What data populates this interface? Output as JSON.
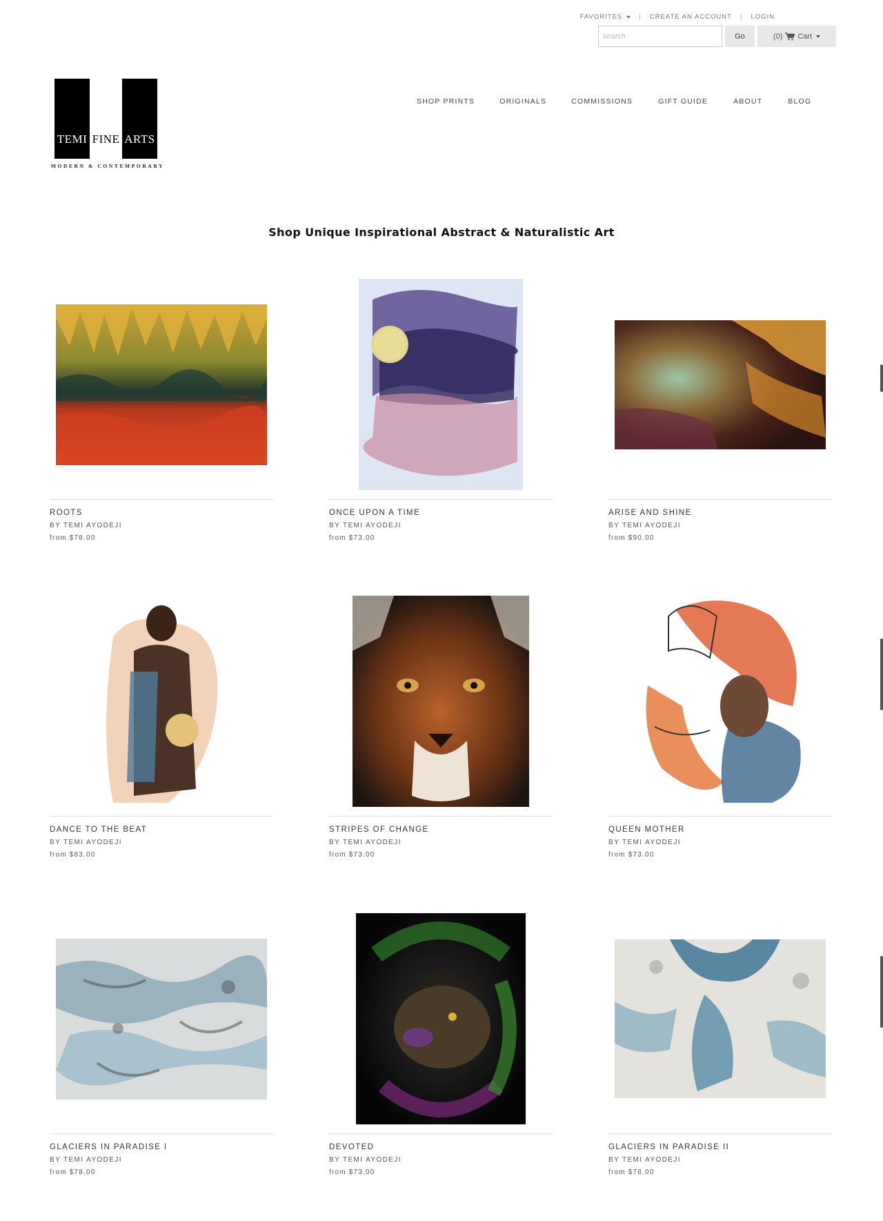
{
  "utility_nav": {
    "favorites": "FAVORITES",
    "create_account": "CREATE AN ACCOUNT",
    "login": "LOGIN",
    "separator": "|"
  },
  "search": {
    "placeholder": "search",
    "go_label": "Go",
    "cart_count": "(0)",
    "cart_label": "Cart"
  },
  "logo": {
    "word1": "TEMI",
    "word2": "FINE",
    "word3": "ARTS",
    "tagline": "MODERN & CONTEMPORARY"
  },
  "nav": {
    "items": [
      "SHOP PRINTS",
      "ORIGINALS",
      "COMMISSIONS",
      "GIFT GUIDE",
      "ABOUT",
      "BLOG"
    ]
  },
  "page": {
    "heading": "Shop Unique Inspirational Abstract & Naturalistic Art"
  },
  "products": [
    {
      "title": "ROOTS",
      "artist": "BY TEMI AYODEJI",
      "price": "from $78.00"
    },
    {
      "title": "ONCE UPON A TIME",
      "artist": "BY TEMI AYODEJI",
      "price": "from $73.00"
    },
    {
      "title": "ARISE AND SHINE",
      "artist": "BY TEMI AYODEJI",
      "price": "from $90.00"
    },
    {
      "title": "DANCE TO THE BEAT",
      "artist": "BY TEMI AYODEJI",
      "price": "from $83.00"
    },
    {
      "title": "STRIPES OF CHANGE",
      "artist": "BY TEMI AYODEJI",
      "price": "from $73.00"
    },
    {
      "title": "QUEEN MOTHER",
      "artist": "BY TEMI AYODEJI",
      "price": "from $73.00"
    },
    {
      "title": "GLACIERS IN PARADISE I",
      "artist": "BY TEMI AYODEJI",
      "price": "from $78.00"
    },
    {
      "title": "DEVOTED",
      "artist": "BY TEMI AYODEJI",
      "price": "from $73.00"
    },
    {
      "title": "GLACIERS IN PARADISE II",
      "artist": "BY TEMI AYODEJI",
      "price": "from $78.00"
    }
  ],
  "colors": {
    "text": "#333333",
    "button_bg": "#e8e8e8",
    "rule": "#dddddd"
  }
}
